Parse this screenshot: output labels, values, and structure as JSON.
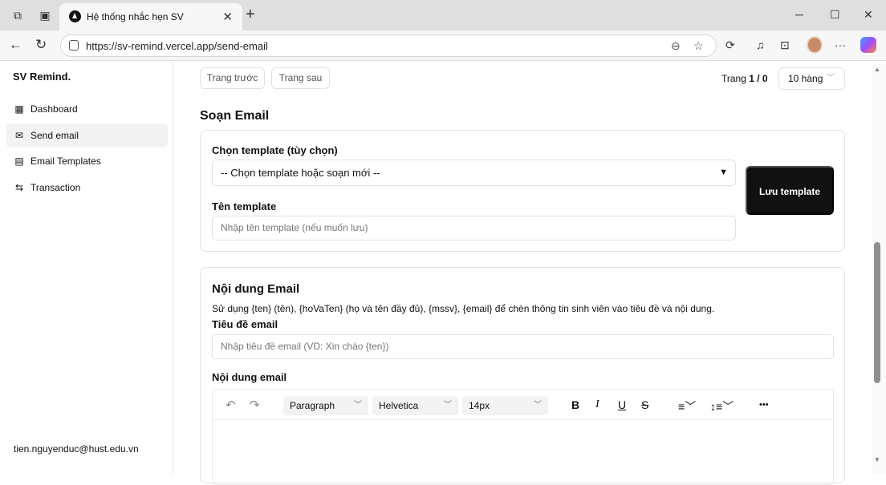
{
  "browser": {
    "tab_title": "Hệ thống nhắc hẹn SV",
    "url": "https://sv-remind.vercel.app/send-email"
  },
  "sidebar": {
    "brand": "SV Remind.",
    "items": [
      {
        "label": "Dashboard",
        "icon": "dashboard-icon"
      },
      {
        "label": "Send email",
        "icon": "mail-icon"
      },
      {
        "label": "Email Templates",
        "icon": "document-icon"
      },
      {
        "label": "Transaction",
        "icon": "swap-icon"
      }
    ],
    "user_email": "tien.nguyenduc@hust.edu.vn"
  },
  "pagination": {
    "prev_label": "Trang trước",
    "next_label": "Trang sau",
    "page_prefix": "Trang",
    "page_value": "1 / 0",
    "rows_label": "10 hàng"
  },
  "compose": {
    "heading": "Soạn Email",
    "template_select_label": "Chọn template (tùy chọn)",
    "template_select_value": "-- Chọn template hoặc soạn mới --",
    "template_name_label": "Tên template",
    "template_name_placeholder": "Nhập tên template (nếu muốn lưu)",
    "save_template_label": "Lưu template"
  },
  "content": {
    "heading": "Nội dung Email",
    "hint": "Sử dụng {ten} (tên), {hoVaTen} (họ và tên đầy đủ), {mssv}, {email} để chèn thông tin sinh viên vào tiêu đề và nội dung.",
    "subject_label": "Tiêu đề email",
    "subject_placeholder": "Nhập tiêu đề email (VD: Xin chào {ten})",
    "body_label": "Nội dung email"
  },
  "editor_toolbar": {
    "block_format": "Paragraph",
    "font_family": "Helvetica",
    "font_size": "14px",
    "bold": "B",
    "italic": "I",
    "underline": "U",
    "strike": "S",
    "more": "•••"
  }
}
